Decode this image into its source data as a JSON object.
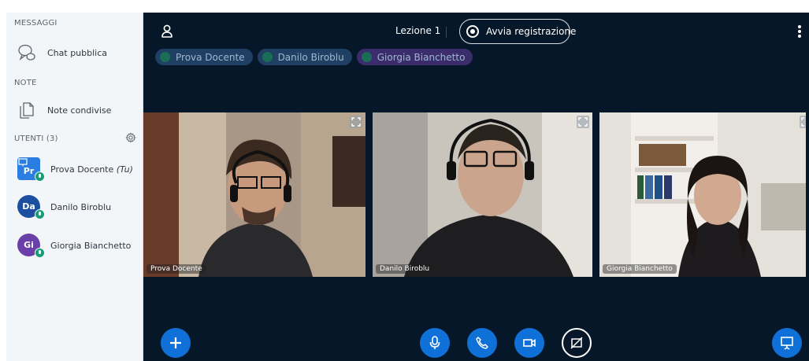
{
  "sidebar": {
    "messages_title": "MESSAGGI",
    "public_chat": "Chat pubblica",
    "notes_title": "NOTE",
    "shared_notes": "Note condivise",
    "users_title": "UTENTI (3)",
    "users": [
      {
        "initials": "Pr",
        "name": "Prova Docente",
        "suffix": "(Tu)",
        "color": "#2a7de1"
      },
      {
        "initials": "Da",
        "name": "Danilo Biroblu",
        "suffix": "",
        "color": "#1c4fa0"
      },
      {
        "initials": "Gi",
        "name": "Giorgia Bianchetto",
        "suffix": "",
        "color": "#6a3fa8"
      }
    ]
  },
  "header": {
    "title": "Lezione 1",
    "record_label": "Avvia registrazione"
  },
  "talkers": [
    {
      "name": "Prova Docente",
      "bg": "#1f3f63",
      "dot": "#1a6e57"
    },
    {
      "name": "Danilo Biroblu",
      "bg": "#1f3f63",
      "dot": "#1a6e57"
    },
    {
      "name": "Giorgia Bianchetto",
      "bg": "#3b2d6b",
      "dot": "#1a6e57"
    }
  ],
  "videos": [
    {
      "label": "Prova Docente"
    },
    {
      "label": "Danilo Biroblu"
    },
    {
      "label": "Giorgia Bianchetto"
    }
  ],
  "controls": {
    "plus_icon": "plus-icon",
    "mic_icon": "microphone-icon",
    "phone_icon": "phone-icon",
    "camera_icon": "video-camera-icon",
    "screenshare_icon": "screenshare-off-icon",
    "presentation_icon": "presentation-icon"
  },
  "colors": {
    "main_bg": "#06172a",
    "sidebar_bg": "#f3f6f9",
    "accent": "#0f70d7",
    "talking_green": "#1a9b77"
  }
}
